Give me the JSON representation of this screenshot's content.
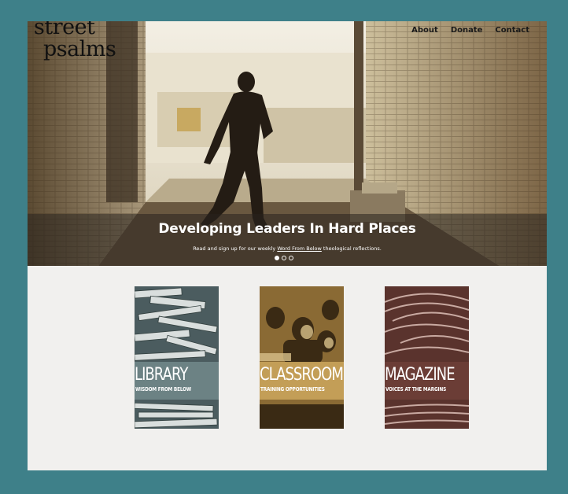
{
  "brand": {
    "line1": "street",
    "line2": "psalms"
  },
  "nav": [
    {
      "label": "About"
    },
    {
      "label": "Donate"
    },
    {
      "label": "Contact"
    }
  ],
  "hero": {
    "headline": "Developing Leaders In Hard Places",
    "sub_before": "Read and sign up for our weekly ",
    "sub_link": "Word From Below",
    "sub_after": " theological reflections.",
    "slides": {
      "current": 1,
      "total": 3
    }
  },
  "cards": [
    {
      "title": "LIBRARY",
      "subtitle": "WISDOM FROM BELOW",
      "color": "#6f8588",
      "text_color": "#ffffff",
      "icon": "books-photo"
    },
    {
      "title": "CLASSROOM",
      "subtitle": "TRAINING OPPORTUNITIES",
      "color": "#c8a35a",
      "text_color": "#ffffff",
      "icon": "classroom-photo"
    },
    {
      "title": "MAGAZINE",
      "subtitle": "VOICES AT THE MARGINS",
      "color": "#6d3e37",
      "text_color": "#ffffff",
      "icon": "magazines-photo"
    }
  ],
  "colors": {
    "frame": "#3e8089",
    "page_bg": "#f1f0ee"
  }
}
